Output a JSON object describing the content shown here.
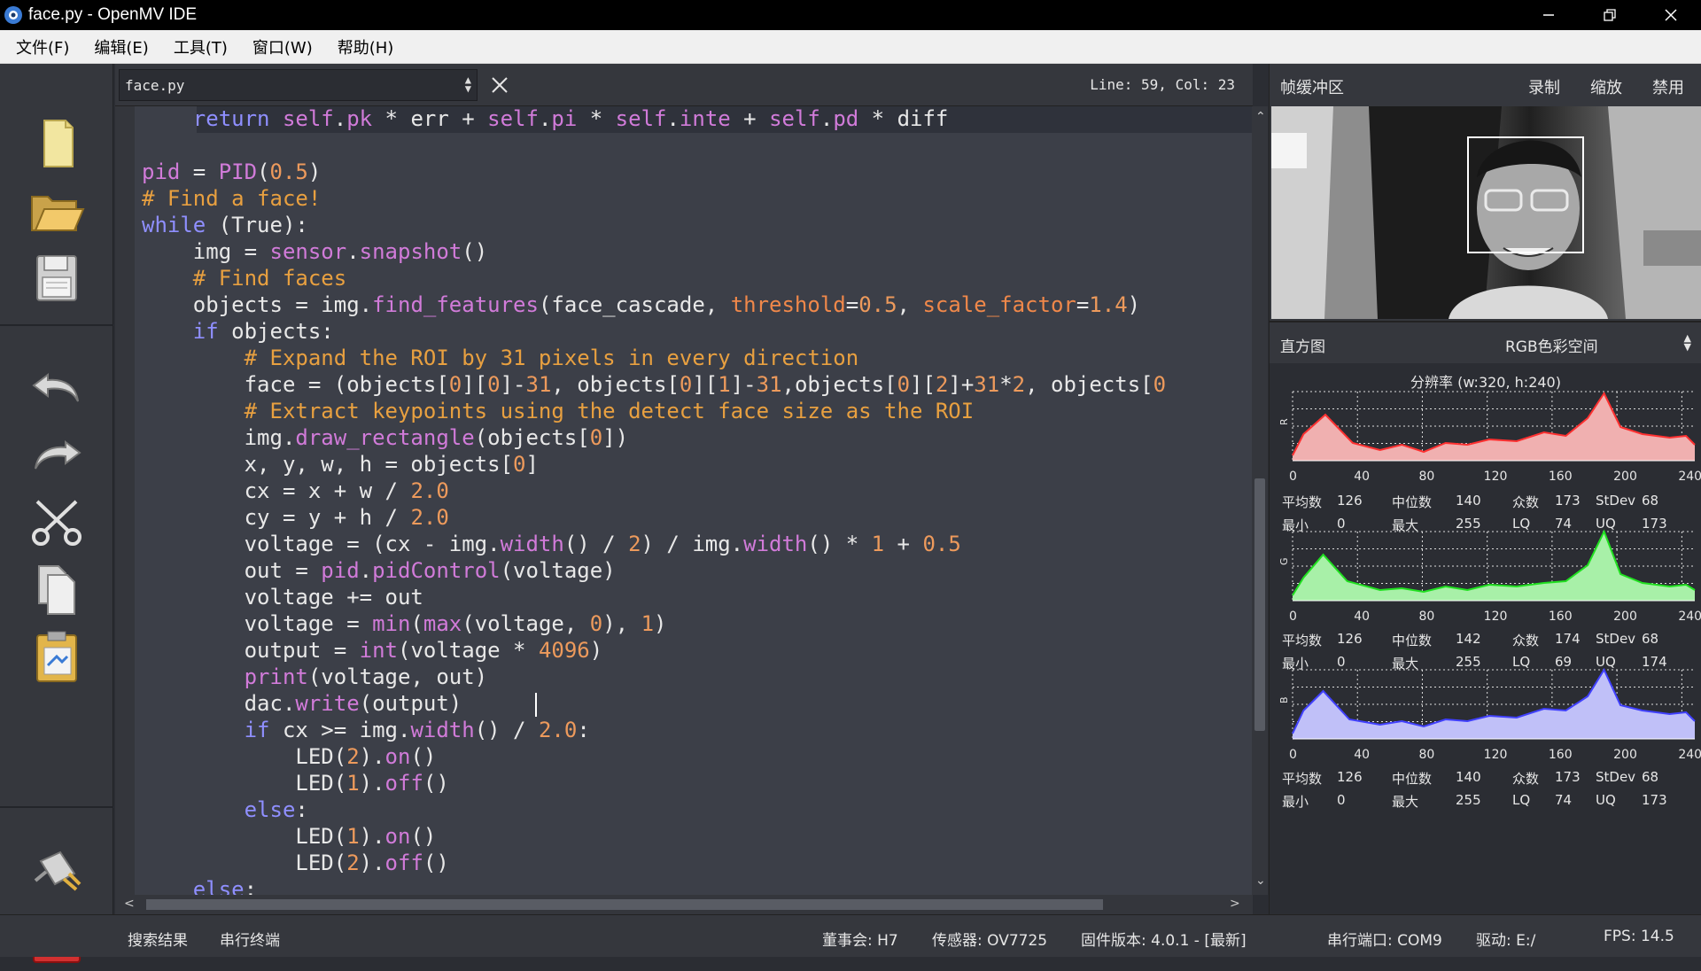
{
  "window": {
    "title": "face.py - OpenMV IDE"
  },
  "menu": [
    "文件(F)",
    "编辑(E)",
    "工具(T)",
    "窗口(W)",
    "帮助(H)"
  ],
  "editor": {
    "file_name": "face.py",
    "cursor_position": "Line: 59,  Col: 23",
    "code_lines": [
      "    return self.pk * err + self.pi * self.inte + self.pd * diff",
      "",
      "pid = PID(0.5)",
      "# Find a face!",
      "while (True):",
      "    img = sensor.snapshot()",
      "    # Find faces",
      "    objects = img.find_features(face_cascade, threshold=0.5, scale_factor=1.4)",
      "    if objects:",
      "        # Expand the ROI by 31 pixels in every direction",
      "        face = (objects[0][0]-31, objects[0][1]-31,objects[0][2]+31*2, objects[0",
      "        # Extract keypoints using the detect face size as the ROI",
      "        img.draw_rectangle(objects[0])",
      "        x, y, w, h = objects[0]",
      "        cx = x + w / 2.0",
      "        cy = y + h / 2.0",
      "        voltage = (cx - img.width() / 2) / img.width() * 1 + 0.5",
      "        out = pid.pidControl(voltage)",
      "        voltage += out",
      "        voltage = min(max(voltage, 0), 1)",
      "        output = int(voltage * 4096)",
      "        print(voltage, out)",
      "        dac.write(output)",
      "        if cx >= img.width() / 2.0:",
      "            LED(2).on()",
      "            LED(1).off()",
      "        else:",
      "            LED(1).on()",
      "            LED(2).off()",
      "    else:"
    ]
  },
  "toolbar_icons": [
    "new-file-icon",
    "open-file-icon",
    "save-file-icon",
    "undo-icon",
    "redo-icon",
    "cut-icon",
    "copy-icon",
    "paste-icon",
    "connect-icon",
    "stop-icon"
  ],
  "frame_buffer": {
    "label": "帧缓冲区",
    "record": "录制",
    "zoom": "缩放",
    "disable": "禁用"
  },
  "histogram": {
    "label": "直方图",
    "color_space": "RGB色彩空间",
    "resolution": "分辨率 (w:320, h:240)",
    "x_ticks": [
      "0",
      "40",
      "80",
      "120",
      "160",
      "200",
      "240"
    ],
    "channels": [
      {
        "name": "R",
        "color": "#f0b0b0",
        "stroke": "#ff3030",
        "stats": {
          "mean_label": "平均数",
          "mean": "126",
          "median_label": "中位数",
          "median": "140",
          "mode_label": "众数",
          "mode": "173",
          "stdev_label": "StDev",
          "stdev": "68",
          "min_label": "最小",
          "min": "0",
          "max_label": "最大",
          "max": "255",
          "lq_label": "LQ",
          "lq": "74",
          "uq_label": "UQ",
          "uq": "173"
        }
      },
      {
        "name": "G",
        "color": "#a8f0a8",
        "stroke": "#20e020",
        "stats": {
          "mean_label": "平均数",
          "mean": "126",
          "median_label": "中位数",
          "median": "142",
          "mode_label": "众数",
          "mode": "174",
          "stdev_label": "StDev",
          "stdev": "68",
          "min_label": "最小",
          "min": "0",
          "max_label": "最大",
          "max": "255",
          "lq_label": "LQ",
          "lq": "69",
          "uq_label": "UQ",
          "uq": "174"
        }
      },
      {
        "name": "B",
        "color": "#c0c0f8",
        "stroke": "#4040ff",
        "stats": {
          "mean_label": "平均数",
          "mean": "126",
          "median_label": "中位数",
          "median": "140",
          "mode_label": "众数",
          "mode": "173",
          "stdev_label": "StDev",
          "stdev": "68",
          "min_label": "最小",
          "min": "0",
          "max_label": "最大",
          "max": "255",
          "lq_label": "LQ",
          "lq": "74",
          "uq_label": "UQ",
          "uq": "173"
        }
      }
    ]
  },
  "statusbar": {
    "search_results": "搜索结果",
    "serial_terminal": "串行终端",
    "board": "董事会: H7",
    "sensor": "传感器: OV7725",
    "firmware": "固件版本: 4.0.1 - [最新]",
    "serial_port": "串行端口: COM9",
    "drive": "驱动: E:/",
    "fps": "FPS:   14.5"
  }
}
